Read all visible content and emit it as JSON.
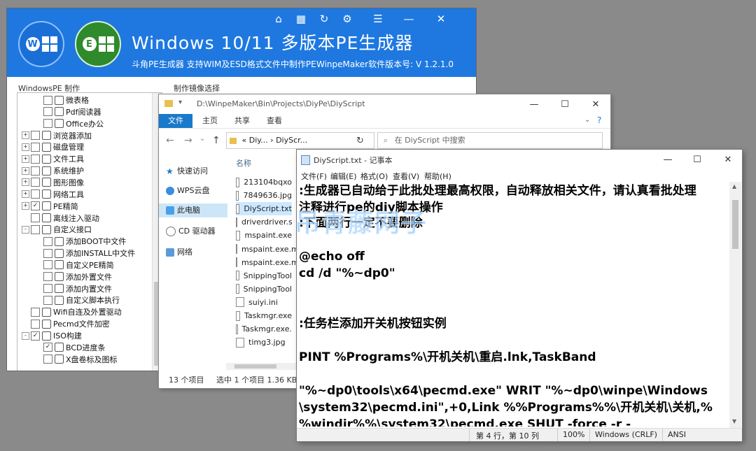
{
  "pe_window": {
    "title": "Windows 10/11 多版本PE生成器",
    "subtitle_left": "斗角PE生成器  支持WIM及ESD格式文件中制作PE",
    "subtitle_right": "WinpeMaker软件版本号:  V 1.2.1.0",
    "toolbar_icons": [
      "home-icon",
      "qr-code-icon",
      "refresh-icon",
      "gear-icon",
      "menu-icon",
      "minimize-icon",
      "close-icon"
    ],
    "left_panel_label": "WindowsPE 制作",
    "right_panel_label": "制作镜像选择",
    "tree": [
      {
        "label": "微表格",
        "indent": 2,
        "checked": false,
        "expander": ""
      },
      {
        "label": "Pdf阅读器",
        "indent": 2,
        "checked": false,
        "expander": ""
      },
      {
        "label": "Office办公",
        "indent": 2,
        "checked": false,
        "expander": ""
      },
      {
        "label": "浏览器添加",
        "indent": 1,
        "checked": false,
        "expander": "+"
      },
      {
        "label": "磁盘管理",
        "indent": 1,
        "checked": false,
        "expander": "+"
      },
      {
        "label": "文件工具",
        "indent": 1,
        "checked": false,
        "expander": "+"
      },
      {
        "label": "系统维护",
        "indent": 1,
        "checked": false,
        "expander": "+"
      },
      {
        "label": "图形图像",
        "indent": 1,
        "checked": false,
        "expander": "+"
      },
      {
        "label": "网络工具",
        "indent": 1,
        "checked": false,
        "expander": "+"
      },
      {
        "label": "PE精简",
        "indent": 1,
        "checked": true,
        "expander": "+"
      },
      {
        "label": "离线注入驱动",
        "indent": 1,
        "checked": false,
        "expander": ""
      },
      {
        "label": "自定义接口",
        "indent": 1,
        "checked": false,
        "expander": "-"
      },
      {
        "label": "添加BOOT中文件",
        "indent": 2,
        "checked": false,
        "expander": ""
      },
      {
        "label": "添加INSTALL中文件",
        "indent": 2,
        "checked": false,
        "expander": ""
      },
      {
        "label": "自定义PE精简",
        "indent": 2,
        "checked": false,
        "expander": ""
      },
      {
        "label": "添加外置文件",
        "indent": 2,
        "checked": false,
        "expander": ""
      },
      {
        "label": "添加内置文件",
        "indent": 2,
        "checked": false,
        "expander": ""
      },
      {
        "label": "自定义脚本执行",
        "indent": 2,
        "checked": false,
        "expander": ""
      },
      {
        "label": "Wifi自连及外置驱动",
        "indent": 1,
        "checked": false,
        "expander": ""
      },
      {
        "label": "Pecmd文件加密",
        "indent": 1,
        "checked": false,
        "expander": ""
      },
      {
        "label": "ISO构建",
        "indent": 1,
        "checked": true,
        "expander": "-"
      },
      {
        "label": "BCD进度条",
        "indent": 2,
        "checked": true,
        "expander": ""
      },
      {
        "label": "X盘卷标及图标",
        "indent": 2,
        "checked": false,
        "expander": ""
      }
    ]
  },
  "explorer": {
    "path": "D:\\WinpeMaker\\Bin\\Projects\\DiyPe\\DiyScript",
    "ribbon_tabs": [
      "文件",
      "主页",
      "共享",
      "查看"
    ],
    "address_text": "«  Diy...  ›  DiyScr...",
    "search_placeholder": "在 DiyScript 中搜索",
    "sidebar": [
      "快速访问",
      "WPS云盘",
      "此电脑",
      "CD 驱动器",
      "网络"
    ],
    "column_header": "名称",
    "files": [
      "213104bqxo",
      "7849636.jpg",
      "DiyScript.txt",
      "driverdriver.s",
      "mspaint.exe",
      "mspaint.exe.m",
      "mspaint.exe.m",
      "SnippingTool",
      "SnippingTool",
      "suiyi.ini",
      "Taskmgr.exe",
      "Taskmgr.exe.",
      "timg3.jpg"
    ],
    "selected_file_index": 2,
    "status_count": "13 个项目",
    "status_selected": "选中 1 个项目  1.36 KB"
  },
  "notepad": {
    "title": "DiyScript.txt - 记事本",
    "menus": [
      "文件(F)",
      "编辑(E)",
      "格式(O)",
      "查看(V)",
      "帮助(H)"
    ],
    "lines": [
      ":生成器已自动给于此批处理最高权限，自动释放相关文件，请认真看批处理",
      "注释进行pe的diy脚本操作",
      ":下面两行一定不要删除",
      "",
      "@echo off",
      "cd /d \"%~dp0\"",
      "",
      "",
      ":任务栏添加开关机按钮实例",
      "",
      "PINT %Programs%\\开机关机\\重启.lnk,TaskBand",
      "",
      "\"%~dp0\\tools\\x64\\pecmd.exe\" WRIT \"%~dp0\\winpe\\Windows",
      "\\system32\\pecmd.ini\",+0,Link %%Programs%%\\开机关机\\关机,%",
      "%windir%%\\system32\\pecmd.exe SHUT -force -r -"
    ],
    "status": {
      "position": "第 4 行，第 10 列",
      "zoom": "100%",
      "line_ending": "Windows (CRLF)",
      "encoding": "ANSI"
    }
  },
  "watermark": "吊青藤网子"
}
